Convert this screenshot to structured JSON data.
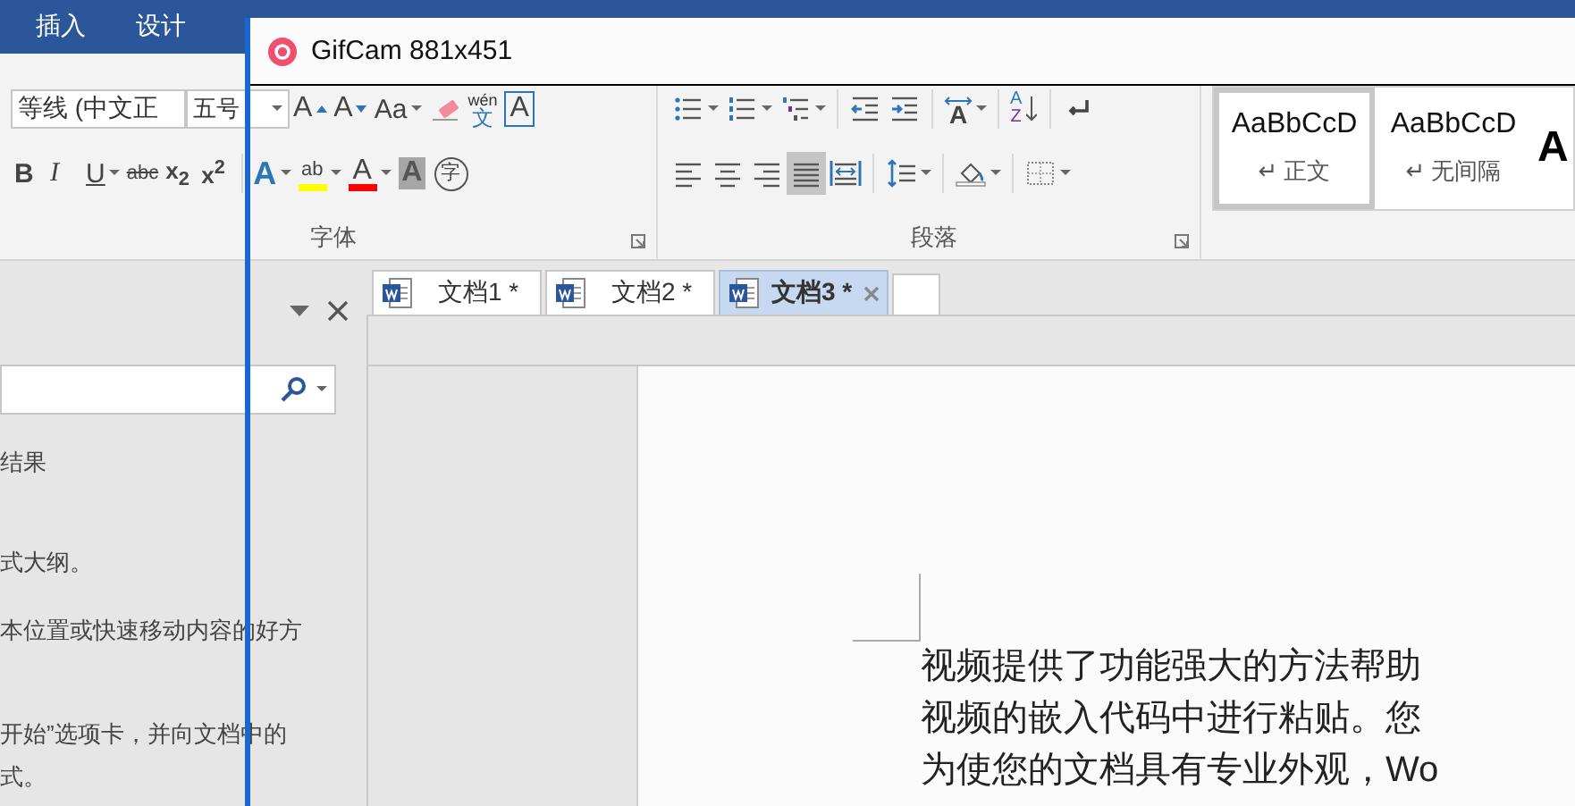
{
  "word_tabs": [
    {
      "label": "插入"
    },
    {
      "label": "设计"
    }
  ],
  "gifcam": {
    "title": "GifCam 881x451"
  },
  "font_group": {
    "label": "字体",
    "font": "等线 (中文正",
    "size": "五号",
    "row1": [
      {
        "kind": "grow",
        "label": "A"
      },
      {
        "kind": "shrink",
        "label": "A"
      },
      {
        "kind": "case",
        "label": "Aa",
        "menu": true
      },
      {
        "kind": "eraser"
      },
      {
        "kind": "pinyin",
        "label": "文",
        "ruby": "wén"
      },
      {
        "kind": "boxed",
        "label": "A"
      }
    ],
    "row2": [
      {
        "kind": "bold",
        "label": "B"
      },
      {
        "kind": "italic",
        "label": "I"
      },
      {
        "kind": "underline",
        "label": "U",
        "menu": true
      },
      {
        "kind": "strike",
        "label": "abc"
      },
      {
        "kind": "script",
        "label": "x$_{2}$"
      },
      {
        "kind": "script",
        "label": "x$^{2}$"
      },
      {
        "kind": "effect",
        "label": "A",
        "menu": true
      },
      {
        "kind": "highlight",
        "label": "ab",
        "color": "#ffff00",
        "menu": true
      },
      {
        "kind": "fontcolor",
        "label": "A",
        "color": "#ff0000",
        "menu": true
      },
      {
        "kind": "shade",
        "label": "A"
      },
      {
        "kind": "enclose",
        "label": "字"
      }
    ]
  },
  "paragraph_group": {
    "label": "段落",
    "row1": [
      {
        "kind": "bullets",
        "menu": true
      },
      {
        "kind": "numbering",
        "menu": true
      },
      {
        "kind": "multilevel",
        "menu": true
      },
      {
        "kind": "outdent"
      },
      {
        "kind": "indent"
      },
      {
        "kind": "asian",
        "label": "A",
        "menu": true
      },
      {
        "kind": "sort",
        "label": "A",
        "ruby": "Z"
      },
      {
        "kind": "marks"
      }
    ],
    "alignment": [
      {
        "kind": "left",
        "selected": false
      },
      {
        "kind": "center",
        "selected": false
      },
      {
        "kind": "right",
        "selected": false
      },
      {
        "kind": "justify",
        "selected": true
      },
      {
        "kind": "distribute",
        "selected": false
      }
    ],
    "row2": [
      {
        "kind": "spacing",
        "menu": true
      },
      {
        "kind": "shading",
        "menu": true
      },
      {
        "kind": "borders",
        "menu": true
      }
    ]
  },
  "styles": [
    {
      "sample": "AaBbCcD",
      "name": "↵ 正文",
      "selected": true
    },
    {
      "sample": "AaBbCcD",
      "name": "↵ 无间隔",
      "selected": false
    },
    {
      "sample": "A",
      "selected": false
    }
  ],
  "navigation_pane": {
    "results": [
      "结果",
      "式大纲。",
      "本位置或快速移动内容的好方",
      "开始”选项卡，并向文档中的",
      "式。"
    ]
  },
  "document_tabs": [
    {
      "title": "文档1 *",
      "selected": false
    },
    {
      "title": "文档2 *",
      "selected": false
    },
    {
      "title": "文档3 *",
      "selected": true
    }
  ],
  "document": {
    "lines": [
      "视频提供了功能强大的方法帮助",
      "视频的嵌入代码中进行粘贴。您",
      "为使您的文档具有专业外观，Wo"
    ]
  }
}
